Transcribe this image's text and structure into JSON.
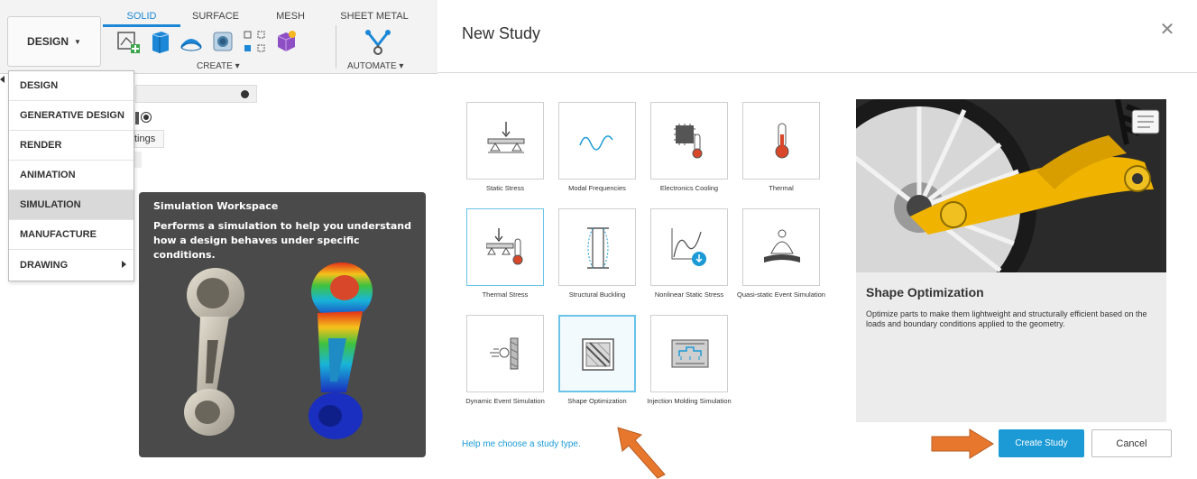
{
  "toolbar": {
    "workspace_button": "DESIGN",
    "tabs": [
      "SOLID",
      "SURFACE",
      "MESH",
      "SHEET METAL"
    ],
    "active_tab": "SOLID",
    "groups": [
      "CREATE ▾",
      "AUTOMATE ▾"
    ],
    "partial_text": "tings",
    "accent_color": "#1b87d6"
  },
  "workspace_menu": {
    "items": [
      "DESIGN",
      "GENERATIVE DESIGN",
      "RENDER",
      "ANIMATION",
      "SIMULATION",
      "MANUFACTURE",
      "DRAWING"
    ],
    "active": "SIMULATION"
  },
  "tooltip": {
    "title": "Simulation Workspace",
    "description": "Performs a simulation to help you understand how a design behaves under specific conditions."
  },
  "dialog": {
    "title": "New Study",
    "close_icon": "close-icon",
    "studies": [
      {
        "label": "Static Stress",
        "icon": "static-stress-icon"
      },
      {
        "label": "Modal Frequencies",
        "icon": "modal-frequencies-icon"
      },
      {
        "label": "Electronics Cooling",
        "icon": "electronics-cooling-icon"
      },
      {
        "label": "Thermal",
        "icon": "thermal-icon"
      },
      {
        "label": "Thermal Stress",
        "icon": "thermal-stress-icon"
      },
      {
        "label": "Structural Buckling",
        "icon": "structural-buckling-icon"
      },
      {
        "label": "Nonlinear Static Stress",
        "icon": "nonlinear-static-stress-icon"
      },
      {
        "label": "Quasi-static Event Simulation",
        "icon": "quasi-static-event-icon"
      },
      {
        "label": "Dynamic Event Simulation",
        "icon": "dynamic-event-icon"
      },
      {
        "label": "Shape Optimization",
        "icon": "shape-optimization-icon"
      },
      {
        "label": "Injection Molding Simulation",
        "icon": "injection-molding-icon"
      }
    ],
    "selected": "Shape Optimization",
    "help_link": "Help me choose a study type.",
    "preview": {
      "title": "Shape Optimization",
      "description": "Optimize parts to make them lightweight and structurally efficient based on the loads and boundary conditions applied to the geometry."
    },
    "create_button": "Create Study",
    "cancel_button": "Cancel",
    "accent_color": "#1b9ad6",
    "annotation_arrow_color": "#e8772e"
  }
}
